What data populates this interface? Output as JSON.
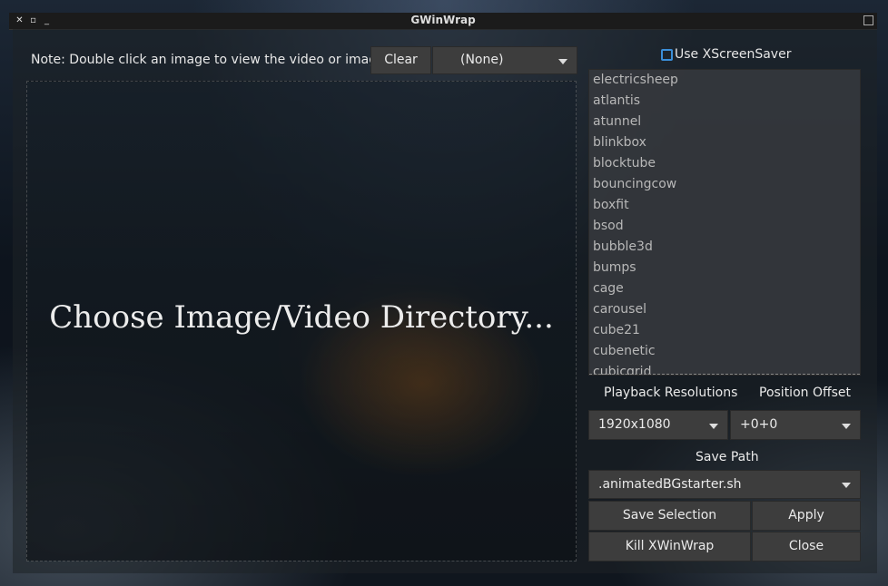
{
  "window": {
    "title": "GWinWrap"
  },
  "toolbar": {
    "note": "Note: Double click an image to view the video or image.",
    "clear_label": "Clear",
    "filter_value": "(None)"
  },
  "preview": {
    "placeholder": "Choose Image/Video Directory..."
  },
  "xscreensaver": {
    "checkbox_label": "Use XScreenSaver",
    "checked": false,
    "items": [
      "electricsheep",
      "atlantis",
      "atunnel",
      "blinkbox",
      "blocktube",
      "bouncingcow",
      "boxfit",
      "bsod",
      "bubble3d",
      "bumps",
      "cage",
      "carousel",
      "cube21",
      "cubenetic",
      "cubicgrid"
    ]
  },
  "settings": {
    "playback_label": "Playback Resolutions",
    "position_label": "Position Offset",
    "resolution_value": "1920x1080",
    "offset_value": "+0+0",
    "save_path_label": "Save Path",
    "save_path_value": ".animatedBGstarter.sh"
  },
  "actions": {
    "save_selection": "Save Selection",
    "apply": "Apply",
    "kill_xwinwrap": "Kill XWinWrap",
    "close": "Close"
  },
  "colors": {
    "accent": "#3b8fd9",
    "button_bg": "#3d3d3d"
  }
}
